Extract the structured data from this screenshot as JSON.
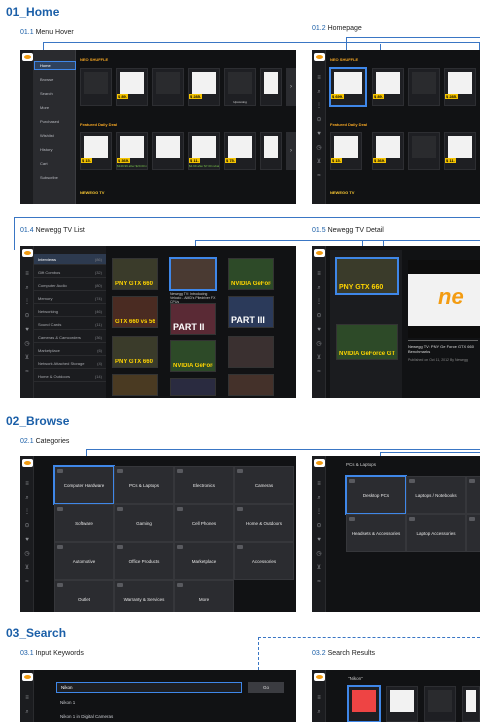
{
  "sections": {
    "home": {
      "title": "01_Home",
      "menu_hover": {
        "num": "01.1",
        "label": "Menu Hover"
      },
      "homepage": {
        "num": "01.2",
        "label": "Homepage"
      },
      "tv_list": {
        "num": "01.4",
        "label": "Newegg TV List"
      },
      "tv_detail": {
        "num": "01.5",
        "label": "Newegg TV Detail"
      }
    },
    "browse": {
      "title": "02_Browse",
      "categories": {
        "num": "02.1",
        "label": "Categories"
      }
    },
    "search": {
      "title": "03_Search",
      "input": {
        "num": "03.1",
        "label": "Input Keywords"
      },
      "results": {
        "num": "03.2",
        "label": "Search Results"
      }
    }
  },
  "menu": {
    "items": [
      "Home",
      "Browse",
      "Search",
      "More",
      "Purchased",
      "Wishlist",
      "History",
      "Cart",
      "Subscribe"
    ]
  },
  "homepage_strips": {
    "deals_label": "NEO SHUFFLE",
    "daily_label": "Featured Daily Deal",
    "tv_label": "NEWEGG TV",
    "row1_prices": [
      "$ 699.",
      "$ 89.",
      "",
      "$ 285.",
      "$ 499."
    ],
    "row1_tail": "Upcoming",
    "row1_tail_sub": "$3.99FM (PST)",
    "row2_prices": [
      "$ 15.",
      "$ 369.",
      "",
      "$ 11.",
      "$ 75."
    ],
    "row2_meta": [
      "$349.99 after $20.00 rebate",
      "$4.99 after $7.00 rebate"
    ]
  },
  "tv_list": {
    "items": [
      {
        "label": "Interviews",
        "count": "(86)"
      },
      {
        "label": "Gift Combos",
        "count": "(32)"
      },
      {
        "label": "Computer Audio",
        "count": "(80)"
      },
      {
        "label": "Memory",
        "count": "(74)"
      },
      {
        "label": "Networking",
        "count": "(46)"
      },
      {
        "label": "Sound Cards",
        "count": "(11)"
      },
      {
        "label": "Cameras & Camcorders",
        "count": "(36)"
      },
      {
        "label": "Marketplace",
        "count": "(6)"
      },
      {
        "label": "Network Attached Storage",
        "count": "(4)"
      },
      {
        "label": "Home & Outdoors",
        "count": "(14)"
      }
    ],
    "thumbs": [
      {
        "title": "PNY GTX 660",
        "white": false
      },
      {
        "title": "",
        "white": false
      },
      {
        "title": "NVIDIA GeForce GTX 660",
        "white": false
      },
      {
        "title": "GTX 660 vs 560",
        "white": false
      },
      {
        "title": "PART II",
        "white": true
      },
      {
        "title": "PART III",
        "white": true
      },
      {
        "title": "PNY GTX 660",
        "white": false
      },
      {
        "title": "NVIDIA GeForce GTX 660",
        "white": false
      },
      {
        "title": "",
        "white": false
      }
    ],
    "selected_caption": "Newegg TV: Introducing Velocio - AMD's Piledriver FX CPUs"
  },
  "tv_detail": {
    "thumb_title": "PNY GTX 660",
    "thumb2_title": "NVIDIA GeForce GTX 660",
    "caption": "Newegg TV: PNY Ge Force GTX 660 Benchmarks",
    "published": "Published on Oct 11, 2012  By Newegg",
    "brand_text": "ne"
  },
  "categories": {
    "items": [
      "Computer Hardware",
      "PCs & Laptops",
      "Electronics",
      "Cameras",
      "Software",
      "Gaming",
      "Cell Phones",
      "Home & Outdoors",
      "Automotive",
      "Office Products",
      "Marketplace",
      "Accessories",
      "Outlet",
      "Warranty & Services",
      "More"
    ],
    "sub_breadcrumb": "PCs & Laptops",
    "sub_items": [
      "Desktop PCs",
      "Laptops / Notebooks",
      "",
      "Headsets & Accessories",
      "Laptop Accessories",
      ""
    ]
  },
  "search": {
    "query": "Nikon",
    "go": "Go",
    "suggestions": [
      "Nikon 1",
      "Nikon 1 in Digital Cameras"
    ],
    "results_query": "\"Nikon\""
  }
}
